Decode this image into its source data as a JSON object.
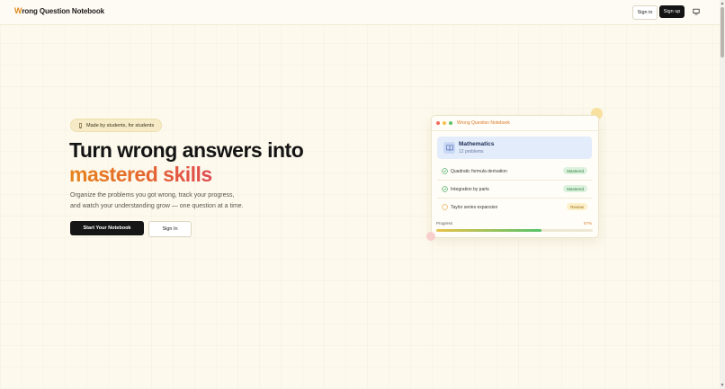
{
  "header": {
    "logo_w": "W",
    "logo_rest": "rong Question Notebook",
    "sign_in": "Sign in",
    "sign_up": "Sign up",
    "theme_icon": "monitor-icon"
  },
  "hero": {
    "badge_icon": "pencil-icon",
    "badge": "Made by students, for students",
    "title_line1": "Turn wrong answers into",
    "title_line2": "mastered skills",
    "subtitle_line1": "Organize the problems you got wrong, track your progress,",
    "subtitle_line2": "and watch your understanding grow — one question at a time.",
    "cta_primary": "Start Your Notebook",
    "cta_secondary": "Sign In"
  },
  "preview_card": {
    "title": "Wrong Question Notebook",
    "subject": {
      "name": "Mathematics",
      "count": "12 problems",
      "icon": "book-icon"
    },
    "items": [
      {
        "label": "Quadratic formula derivation",
        "status": "Mastered",
        "icon": "check-circle-icon"
      },
      {
        "label": "Integration by parts",
        "status": "Mastered",
        "icon": "check-circle-icon"
      },
      {
        "label": "Taylor series expansion",
        "status": "Review",
        "icon": "circle-icon"
      }
    ],
    "progress_label": "Progress",
    "progress_pct": "67%",
    "progress_value": 0.67
  },
  "colors": {
    "accent_orange": "#e6851d",
    "accent_red": "#e04a52",
    "background": "#fdf9ec",
    "primary_button": "#161616",
    "mastered_green": "#2e7d3a",
    "review_amber": "#9b6a10"
  }
}
